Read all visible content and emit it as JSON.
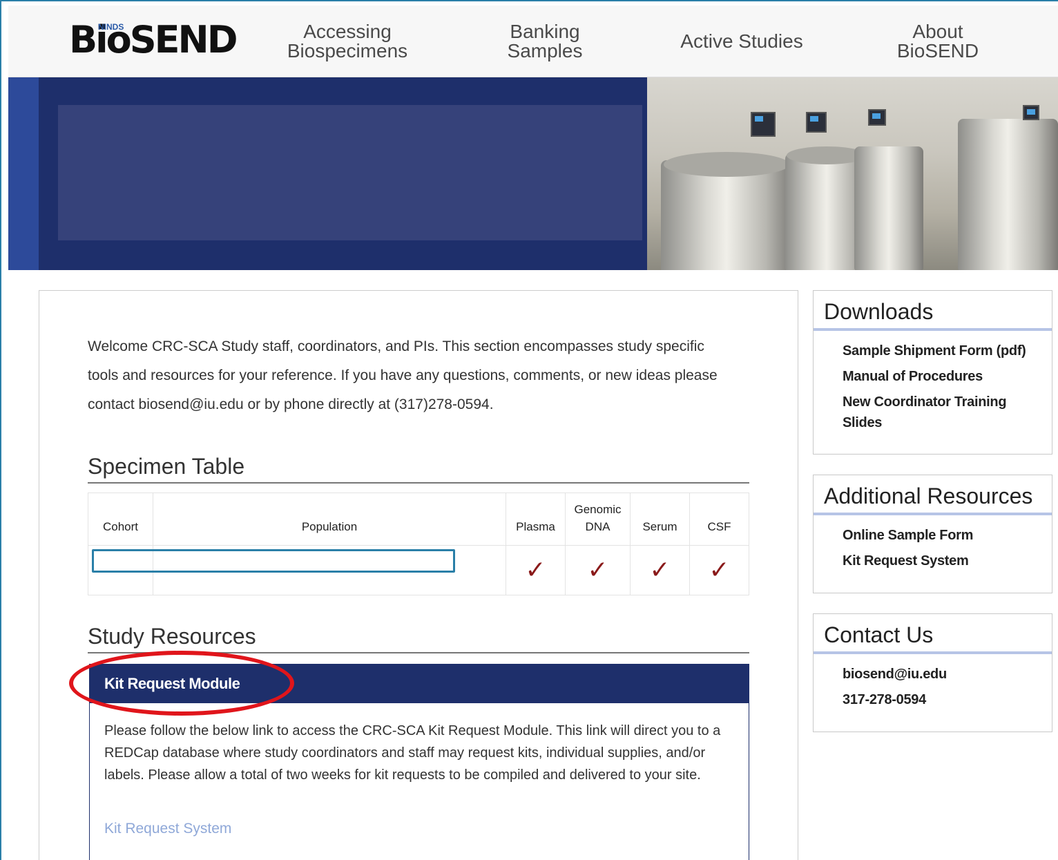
{
  "header": {
    "logo_main": "BioSEND",
    "logo_super": "NINDS",
    "nav": [
      {
        "line1": "Accessing",
        "line2": "Biospecimens"
      },
      {
        "line1": "Banking",
        "line2": "Samples"
      },
      {
        "line1": "Active Studies",
        "line2": ""
      },
      {
        "line1": "About",
        "line2": "BioSEND"
      }
    ]
  },
  "main": {
    "intro": "Welcome CRC-SCA Study staff, coordinators, and PIs. This section encompasses study specific tools and resources for your reference. If you have any questions, comments, or new ideas please contact biosend@iu.edu or by phone directly at (317)278-0594.",
    "specimen_heading": "Specimen Table",
    "table": {
      "headers": [
        "Cohort",
        "Population",
        "Plasma",
        "Genomic DNA",
        "Serum",
        "CSF"
      ],
      "row": {
        "cohort": "",
        "population": "",
        "plasma": "✓",
        "genomic_dna": "✓",
        "serum": "✓",
        "csf": "✓"
      }
    },
    "resources_heading": "Study Resources",
    "resource": {
      "title": "Kit Request Module",
      "body": "Please follow the below link to access the CRC-SCA Kit Request Module. This link will direct you to a REDCap database where study coordinators and staff may request kits, individual supplies, and/or labels. Please allow a total of two weeks for kit requests to be compiled and delivered to your site.",
      "link": "Kit Request System"
    }
  },
  "sidebar": {
    "downloads": {
      "title": "Downloads",
      "links": [
        "Sample Shipment Form (pdf)",
        "Manual of Procedures",
        "New Coordinator Training Slides"
      ]
    },
    "additional": {
      "title": "Additional Resources",
      "links": [
        "Online Sample Form",
        "Kit Request System"
      ]
    },
    "contact": {
      "title": "Contact Us",
      "lines": [
        "biosend@iu.edu",
        "317-278-0594"
      ]
    }
  },
  "colors": {
    "navy": "#1e2f6b",
    "accent_blue": "#2a7fa8",
    "check_red": "#8a1a1a",
    "annotation_red": "#e0151b",
    "link_blue": "#8fa8d8"
  }
}
